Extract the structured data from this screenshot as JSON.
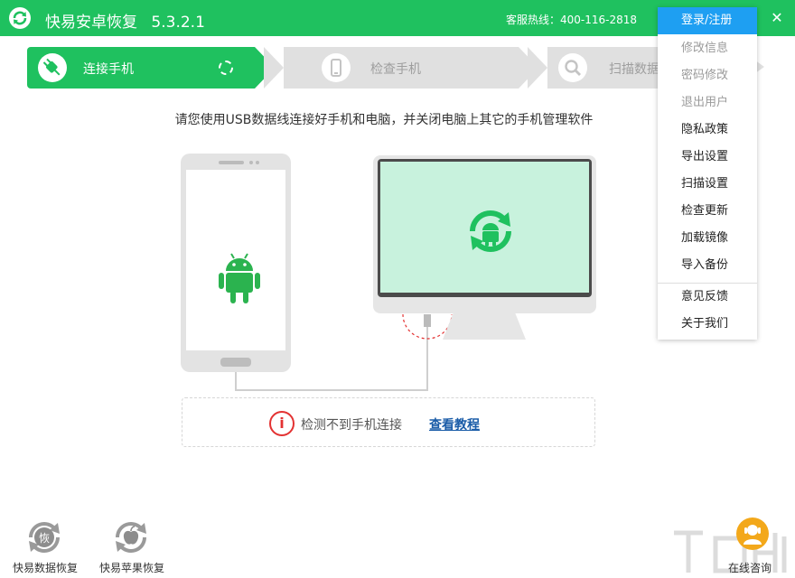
{
  "titlebar": {
    "app_name": "快易安卓恢复",
    "version": "5.3.2.1",
    "hotline": "客服热线：400-116-2818",
    "close_glyph": "✕"
  },
  "steps": [
    {
      "label": "连接手机",
      "icon": "plug-icon",
      "active": true
    },
    {
      "label": "检查手机",
      "icon": "phone-icon",
      "active": false
    },
    {
      "label": "扫描数据",
      "icon": "search-icon",
      "active": false
    }
  ],
  "instruction": "请您使用USB数据线连接好手机和电脑，并关闭电脑上其它的手机管理软件",
  "menu": {
    "login": "登录/注册",
    "items": [
      {
        "label": "修改信息",
        "disabled": true
      },
      {
        "label": "密码修改",
        "disabled": true
      },
      {
        "label": "退出用户",
        "disabled": true
      },
      {
        "label": "隐私政策",
        "disabled": false
      },
      {
        "label": "导出设置",
        "disabled": false
      },
      {
        "label": "扫描设置",
        "disabled": false
      },
      {
        "label": "检查更新",
        "disabled": false
      },
      {
        "label": "加载镜像",
        "disabled": false
      },
      {
        "label": "导入备份",
        "disabled": false
      },
      {
        "label": "意见反馈",
        "disabled": false
      },
      {
        "label": "关于我们",
        "disabled": false
      }
    ]
  },
  "warning": {
    "icon_glyph": "i",
    "text": "检测不到手机连接",
    "link": "查看教程"
  },
  "bottom_apps": [
    {
      "label": "快易数据恢复",
      "icon_text": "恢"
    },
    {
      "label": "快易苹果恢复",
      "icon_text": ""
    }
  ],
  "consult": "在线咨询",
  "colors": {
    "brand_green": "#1fc15f",
    "menu_blue": "#1e9ff2",
    "warning_red": "#e33232",
    "link_blue": "#1a5ca8",
    "screen_green": "#c8f2dd"
  }
}
